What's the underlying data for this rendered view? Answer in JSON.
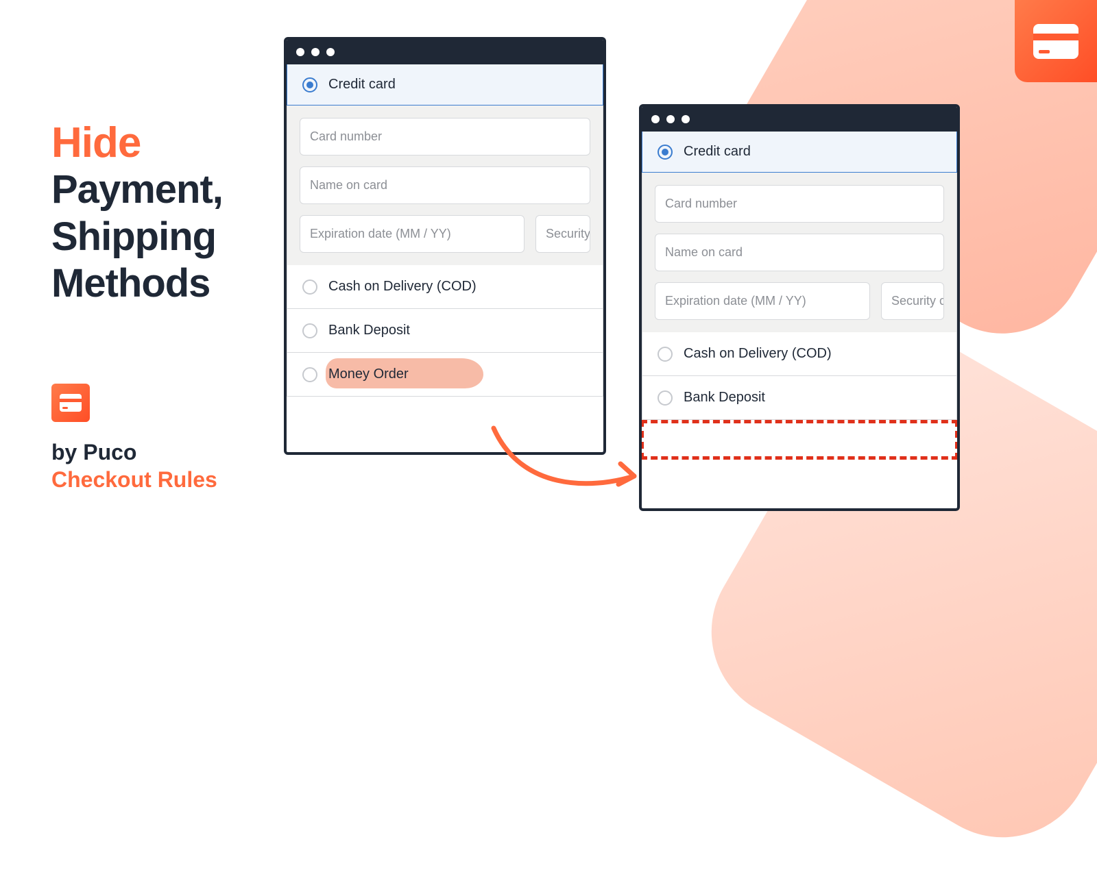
{
  "headline": {
    "hide": "Hide",
    "line1": "Payment,",
    "line2": "Shipping",
    "line3": "Methods"
  },
  "byline": {
    "by": "by Puco",
    "brand": "Checkout Rules"
  },
  "payment": {
    "credit_card": "Credit card",
    "card_number_ph": "Card number",
    "name_on_card_ph": "Name on card",
    "expiration_ph": "Expiration date (MM / YY)",
    "security_ph_short": "Security",
    "security_ph_cut": "Security c",
    "cod": "Cash on Delivery (COD)",
    "bank": "Bank Deposit",
    "money_order": "Money Order"
  }
}
